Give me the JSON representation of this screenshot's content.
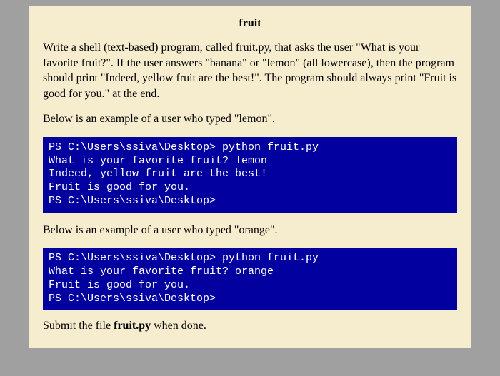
{
  "title": "fruit",
  "para1": "Write a shell (text-based) program, called fruit.py, that asks the user \"What is your favorite fruit?\". If the user answers \"banana\" or \"lemon\" (all lowercase), then the program should print \"Indeed, yellow fruit are the best!\".  The program should always print \"Fruit is good for you.\" at the end.",
  "example1_intro": "Below is an example of a user who typed \"lemon\".",
  "example1_terminal": "PS C:\\Users\\ssiva\\Desktop> python fruit.py\nWhat is your favorite fruit? lemon\nIndeed, yellow fruit are the best!\nFruit is good for you.\nPS C:\\Users\\ssiva\\Desktop>",
  "example2_intro": "Below is an example of a user who typed \"orange\".",
  "example2_terminal": "PS C:\\Users\\ssiva\\Desktop> python fruit.py\nWhat is your favorite fruit? orange\nFruit is good for you.\nPS C:\\Users\\ssiva\\Desktop>",
  "submit_prefix": "Submit the file ",
  "submit_filename": "fruit.py",
  "submit_suffix": " when done."
}
